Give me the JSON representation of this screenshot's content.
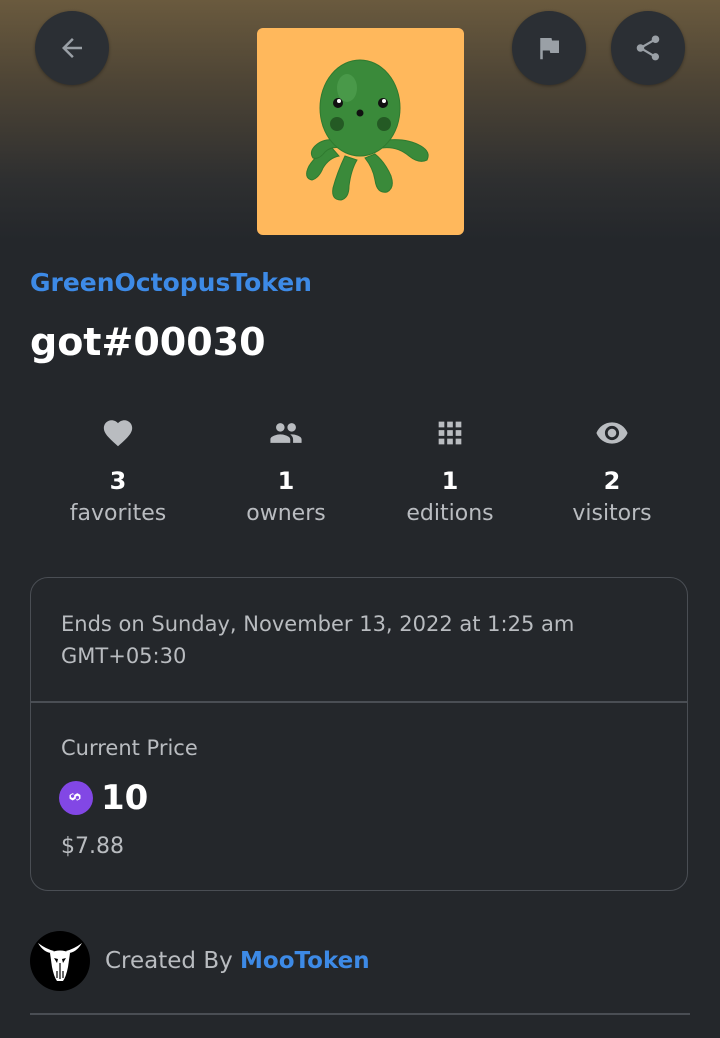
{
  "toolbar": {
    "back_icon": "arrow-left-icon",
    "report_icon": "flag-icon",
    "share_icon": "share-icon"
  },
  "nft": {
    "image_subject": "green octopus on orange background",
    "image_bg_color": "#ffb85c",
    "collection": "GreenOctopusToken",
    "title": "got#00030"
  },
  "stats": [
    {
      "icon": "heart-icon",
      "value": "3",
      "label": "favorites"
    },
    {
      "icon": "people-icon",
      "value": "1",
      "label": "owners"
    },
    {
      "icon": "grid-icon",
      "value": "1",
      "label": "editions"
    },
    {
      "icon": "eye-icon",
      "value": "2",
      "label": "visitors"
    }
  ],
  "auction": {
    "ends_text": "Ends on Sunday, November 13, 2022 at 1:25 am GMT+05:30",
    "price_label": "Current Price",
    "currency_icon": "polygon-matic-icon",
    "price_value": "10",
    "price_usd": "$7.88"
  },
  "creator": {
    "prefix": "Created By",
    "name": "MooToken",
    "avatar": "bull-skull-logo"
  },
  "colors": {
    "background": "#24272b",
    "accent_link": "#3d8ae6",
    "muted_text": "#b9bcc0",
    "matic_purple": "#8247e5"
  }
}
